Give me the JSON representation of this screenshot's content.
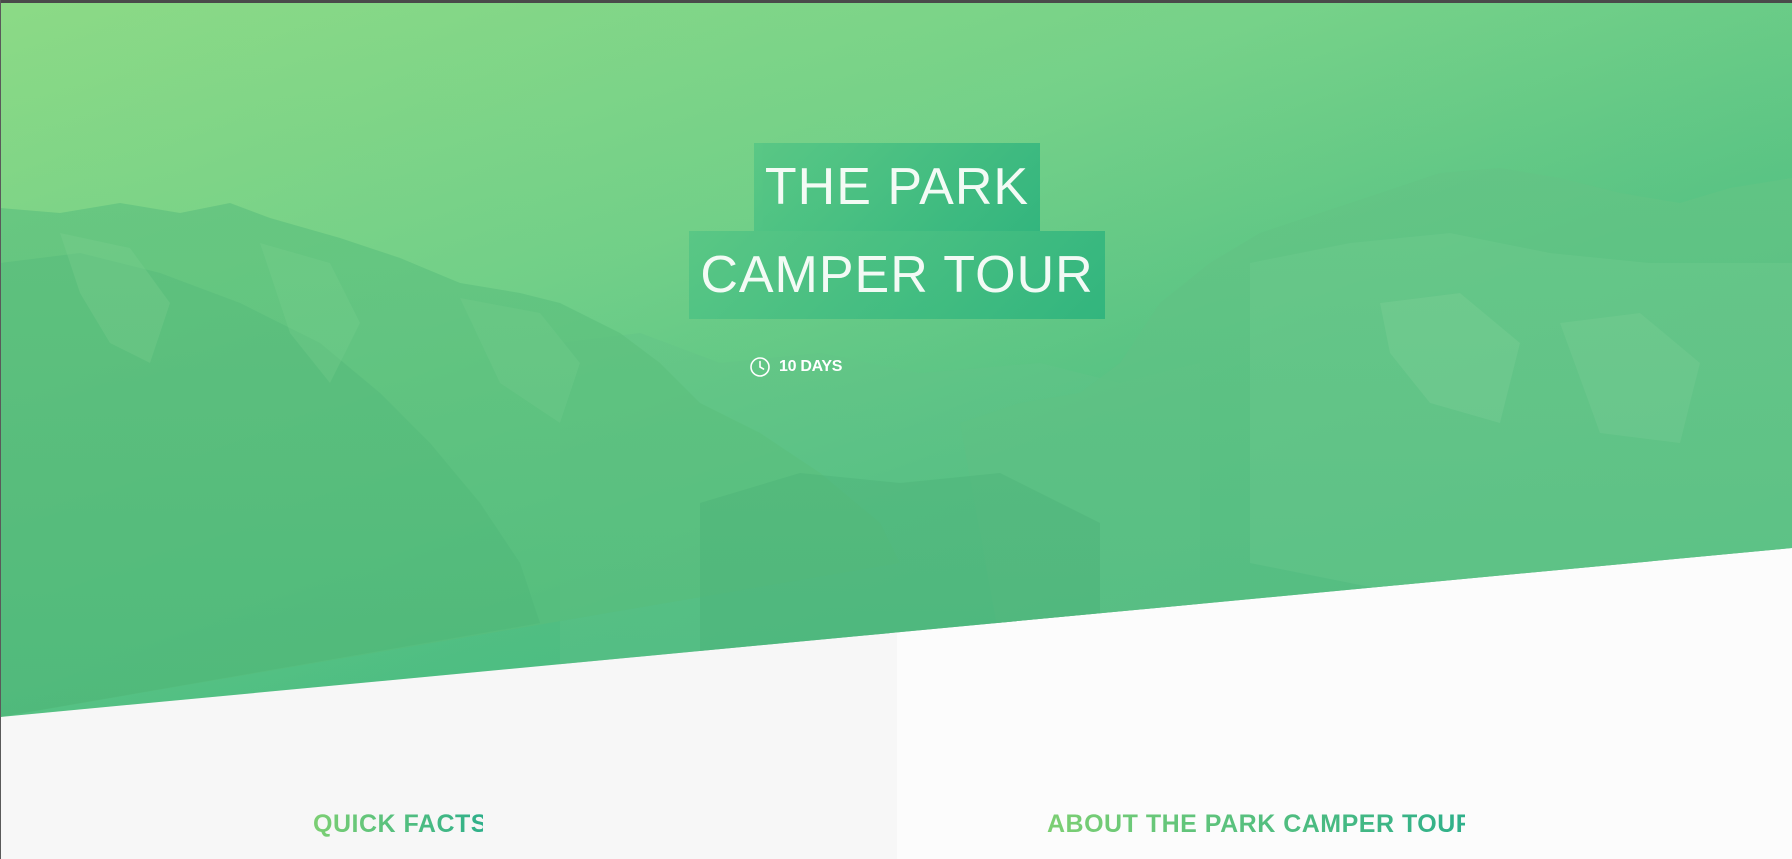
{
  "hero": {
    "title_line_1": "THE PARK",
    "title_line_2": "CAMPER TOUR",
    "duration_icon": "clock-icon",
    "duration_label": "10 DAYS"
  },
  "sections": {
    "quick_facts_title": "QUICK FACTS",
    "about_title": "ABOUT THE PARK CAMPER TOUR"
  },
  "colors": {
    "gradient_start": "#8cda86",
    "gradient_end": "#3fb57e",
    "title_box": "#39b87d",
    "heading_start": "#7ccf73",
    "heading_end": "#2fb08a",
    "background_left": "#f7f7f7",
    "background_right": "#fcfcfc"
  }
}
